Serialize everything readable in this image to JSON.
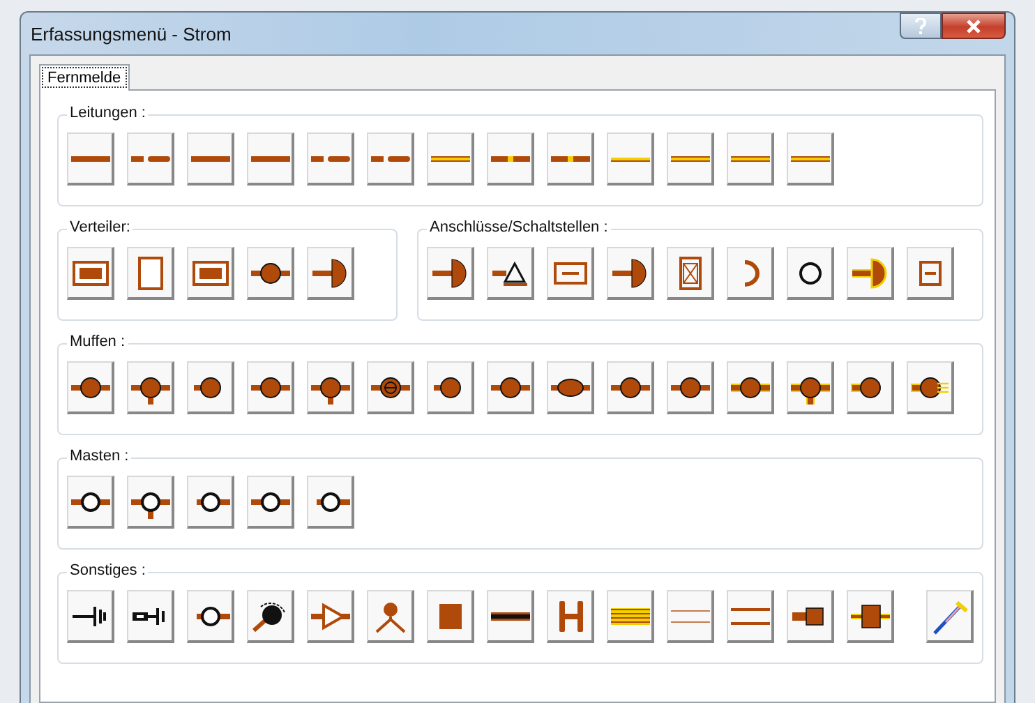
{
  "window": {
    "title": "Erfassungsmenü - Strom"
  },
  "tabs": [
    {
      "label": "Fernmelde",
      "selected": true
    }
  ],
  "rows": [
    [
      {
        "title": "Leitungen :",
        "buttons": [
          {
            "kind": "line"
          },
          {
            "kind": "dash"
          },
          {
            "kind": "line"
          },
          {
            "kind": "line"
          },
          {
            "kind": "dash"
          },
          {
            "kind": "dash"
          },
          {
            "kind": "line-yellow"
          },
          {
            "kind": "dash-yellow"
          },
          {
            "kind": "dash-yellow"
          },
          {
            "kind": "thin-yellow"
          },
          {
            "kind": "line-yellow"
          },
          {
            "kind": "line-yellow"
          },
          {
            "kind": "line-yellow"
          }
        ]
      }
    ],
    [
      {
        "title": "Verteiler:",
        "buttons": [
          {
            "kind": "box-filled"
          },
          {
            "kind": "box-empty"
          },
          {
            "kind": "box-filled"
          },
          {
            "kind": "joint"
          },
          {
            "kind": "terminal"
          }
        ]
      },
      {
        "title": "Anschlüsse/Schaltstellen :",
        "buttons": [
          {
            "kind": "terminal"
          },
          {
            "kind": "triangle"
          },
          {
            "kind": "box-dash"
          },
          {
            "kind": "terminal"
          },
          {
            "kind": "box-cross"
          },
          {
            "kind": "arc"
          },
          {
            "kind": "ring"
          },
          {
            "kind": "terminal-yellow"
          },
          {
            "kind": "small-box"
          }
        ]
      }
    ],
    [
      {
        "title": "Muffen :",
        "buttons": [
          {
            "kind": "joint"
          },
          {
            "kind": "joint-tee"
          },
          {
            "kind": "joint-left"
          },
          {
            "kind": "joint"
          },
          {
            "kind": "joint-tee"
          },
          {
            "kind": "joint-ring"
          },
          {
            "kind": "joint-left"
          },
          {
            "kind": "joint"
          },
          {
            "kind": "oval"
          },
          {
            "kind": "joint"
          },
          {
            "kind": "joint"
          },
          {
            "kind": "joint-yellow"
          },
          {
            "kind": "joint-tee-yellow"
          },
          {
            "kind": "joint-left-yellow"
          },
          {
            "kind": "joint-fork"
          }
        ]
      }
    ],
    [
      {
        "title": "Masten :",
        "buttons": [
          {
            "kind": "mast"
          },
          {
            "kind": "mast-tee"
          },
          {
            "kind": "mast-left"
          },
          {
            "kind": "mast"
          },
          {
            "kind": "mast-left"
          }
        ]
      }
    ],
    [
      {
        "title": "Sonstiges :",
        "buttons": [
          {
            "kind": "earth"
          },
          {
            "kind": "plug-earth"
          },
          {
            "kind": "mast-left"
          },
          {
            "kind": "dial"
          },
          {
            "kind": "amplifier"
          },
          {
            "kind": "person"
          },
          {
            "kind": "square"
          },
          {
            "kind": "line-black"
          },
          {
            "kind": "h-beam"
          },
          {
            "kind": "stripes"
          },
          {
            "kind": "double-thin"
          },
          {
            "kind": "double"
          },
          {
            "kind": "plug"
          },
          {
            "kind": "plug-yellow"
          },
          {
            "kind": "pen"
          }
        ]
      }
    ]
  ]
}
